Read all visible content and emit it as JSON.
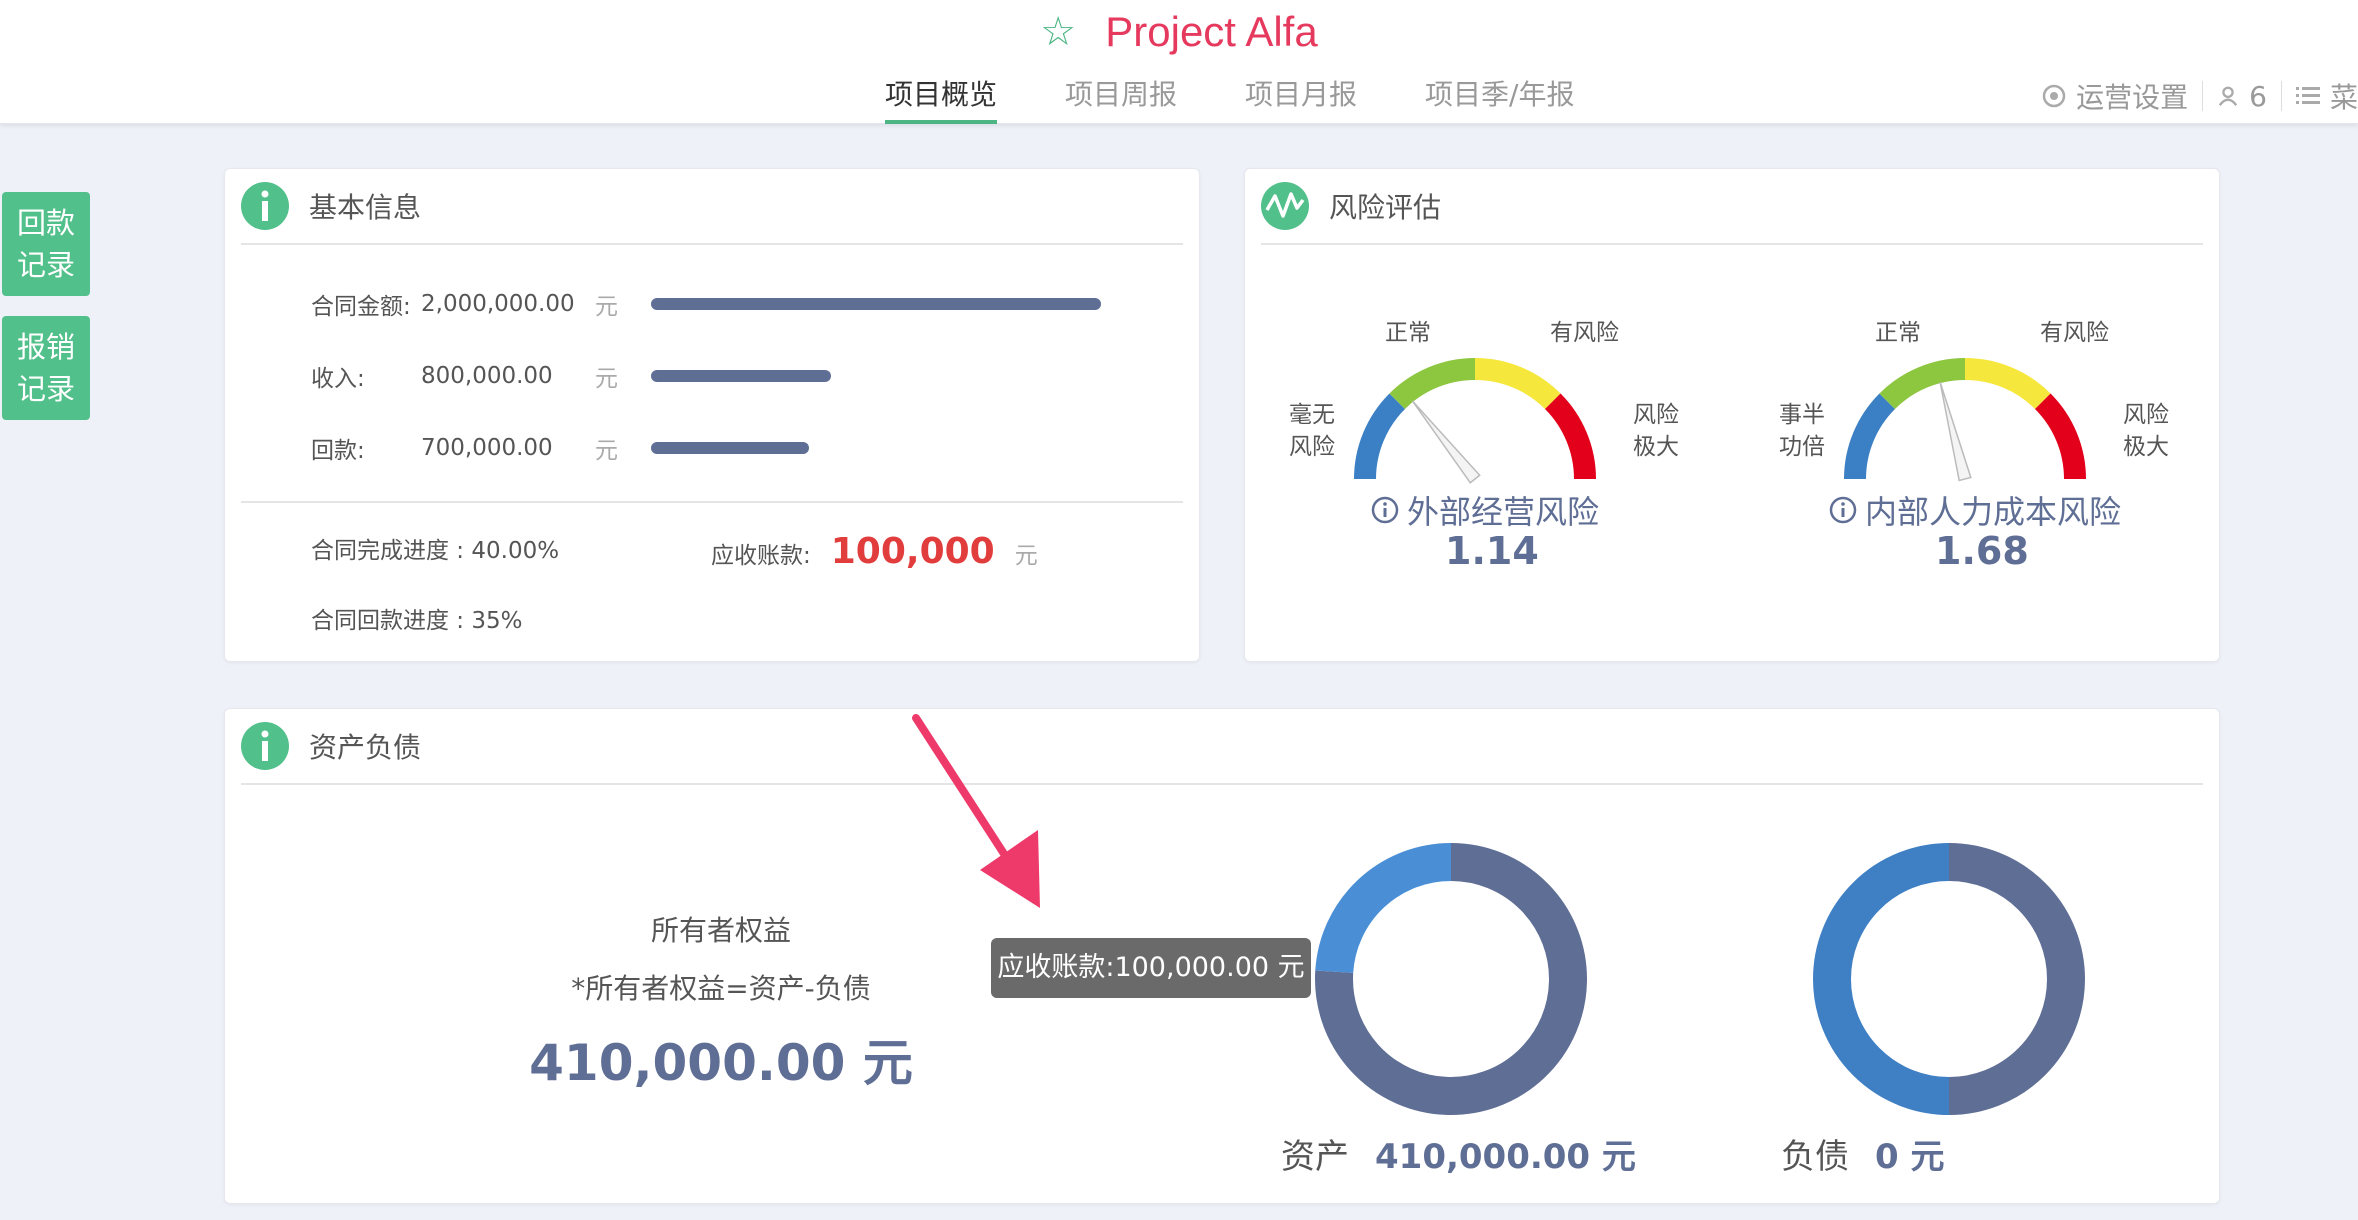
{
  "header": {
    "title": "Project Alfa",
    "tabs": [
      "项目概览",
      "项目周报",
      "项目月报",
      "项目季/年报"
    ],
    "ops_settings": "运营设置",
    "user_count": "6",
    "menu": "菜"
  },
  "side_buttons": {
    "payments": [
      "回款",
      "记录"
    ],
    "reimburse": [
      "报销",
      "记录"
    ]
  },
  "basic_info": {
    "title": "基本信息",
    "rows": [
      {
        "label": "合同金额:",
        "value": "2,000,000.00",
        "unit": "元",
        "amount": 2000000
      },
      {
        "label": "收入:",
        "value": "800,000.00",
        "unit": "元",
        "amount": 800000
      },
      {
        "label": "回款:",
        "value": "700,000.00",
        "unit": "元",
        "amount": 700000
      }
    ],
    "contract_progress": "合同完成进度 : 40.00%",
    "payment_progress": "合同回款进度 : 35%",
    "receivable_label": "应收账款:",
    "receivable_value": "100,000",
    "receivable_unit": "元"
  },
  "risk": {
    "title": "风险评估",
    "gauges": [
      {
        "name": "外部经营风险",
        "value": "1.14",
        "level": 1.14,
        "labels": {
          "left": [
            "毫无",
            "风险"
          ],
          "mid_left": "正常",
          "mid_right": "有风险",
          "right": [
            "风险",
            "极大"
          ]
        }
      },
      {
        "name": "内部人力成本风险",
        "value": "1.68",
        "level": 1.68,
        "labels": {
          "left": [
            "事半",
            "功倍"
          ],
          "mid_left": "正常",
          "mid_right": "有风险",
          "right": [
            "风险",
            "极大"
          ]
        }
      }
    ],
    "colors": [
      "#3b7fc4",
      "#8dc63f",
      "#f5e73b",
      "#e3001b"
    ]
  },
  "assets": {
    "title": "资产负债",
    "equity_label": "所有者权益",
    "equity_formula": "*所有者权益=资产-负债",
    "equity_value": "410,000.00 元",
    "asset_label": "资产",
    "asset_value": "410,000.00 元",
    "liability_label": "负债",
    "liability_value": "0 元",
    "tooltip": "应收账款:100,000.00 元",
    "asset_donut": {
      "receivable_fraction": 0.24
    },
    "liability_donut": {
      "fraction": 0.5
    },
    "colors": {
      "dark": "#5f6e94",
      "light": "#4a8fd6",
      "mid": "#3f7fc4"
    }
  }
}
